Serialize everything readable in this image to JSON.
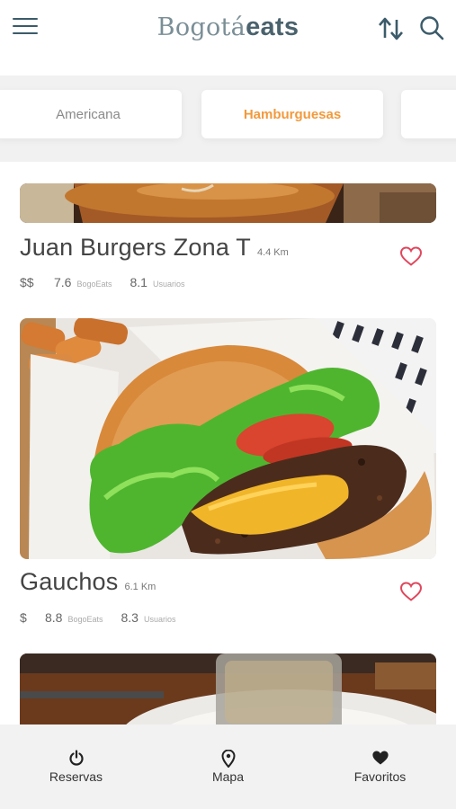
{
  "header": {
    "brand_light": "Bogotá",
    "brand_bold": "eats",
    "menu_icon": "hamburger-menu-icon",
    "sort_icon": "sort-arrows-icon",
    "search_icon": "search-icon"
  },
  "categories": [
    {
      "label": "Americana",
      "active": false
    },
    {
      "label": "Hamburguesas",
      "active": true
    },
    {
      "label": "",
      "active": false
    }
  ],
  "restaurants": [
    {
      "name": "Juan Burgers Zona T",
      "distance": "4.4 Km",
      "price": "$$",
      "bogoeats_score": "7.6",
      "bogoeats_label": "BogoEats",
      "users_score": "8.1",
      "users_label": "Usuarios",
      "favorite_icon": "heart-outline-icon"
    },
    {
      "name": "Gauchos",
      "distance": "6.1 Km",
      "price": "$",
      "bogoeats_score": "8.8",
      "bogoeats_label": "BogoEats",
      "users_score": "8.3",
      "users_label": "Usuarios",
      "favorite_icon": "heart-outline-icon"
    }
  ],
  "bottom_nav": [
    {
      "label": "Reservas",
      "icon": "power-icon"
    },
    {
      "label": "Mapa",
      "icon": "map-pin-icon"
    },
    {
      "label": "Favoritos",
      "icon": "heart-filled-icon"
    }
  ],
  "colors": {
    "accent": "#f29a3c",
    "heart": "#e0475d",
    "brand": "#4a626d",
    "nav_bg": "#f2f2f2"
  }
}
